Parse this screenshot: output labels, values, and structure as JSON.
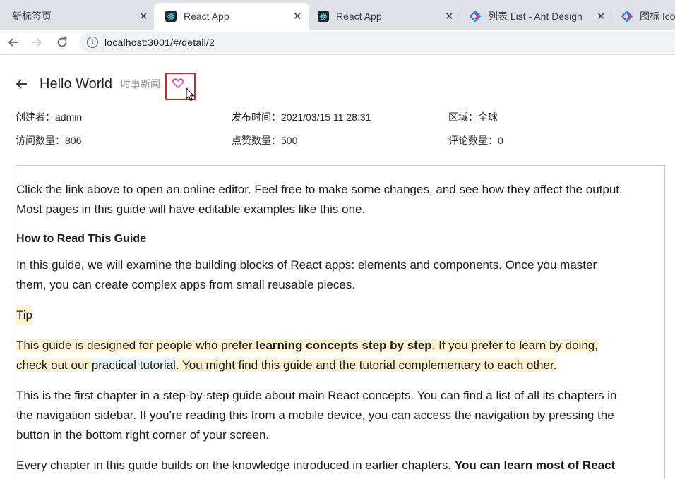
{
  "browser": {
    "tabs": [
      {
        "title": "新标签页",
        "favicon": "none"
      },
      {
        "title": "React App",
        "favicon": "react-icon"
      },
      {
        "title": "React App",
        "favicon": "react-icon"
      },
      {
        "title": "列表 List - Ant Design",
        "favicon": "ant-design-icon"
      },
      {
        "title": "图标 Icon",
        "favicon": "ant-design-icon"
      }
    ],
    "close_glyph": "✕",
    "url": "localhost:3001/#/detail/2"
  },
  "header": {
    "title": "Hello World",
    "subtitle": "时事新闻",
    "heart_color": "#eb2f96"
  },
  "descriptions": [
    {
      "label": "创建者：",
      "value": "admin"
    },
    {
      "label": "发布时间：",
      "value": "2021/03/15 11:28:31"
    },
    {
      "label": "区域：",
      "value": "全球"
    },
    {
      "label": "访问数量：",
      "value": "806"
    },
    {
      "label": "点赞数量：",
      "value": "500"
    },
    {
      "label": "评论数量：",
      "value": "0"
    }
  ],
  "article": {
    "intro_line1": "Click the link above to open an online editor. Feel free to make some changes, and see how they affect the output.",
    "intro_line2": "Most pages in this guide will have editable examples like this one.",
    "heading": "How to Read This Guide",
    "para2_line1": "In this guide, we will examine the building blocks of React apps: elements and components. Once you master",
    "para2_line2": "them, you can create complex apps from small reusable pieces.",
    "tip_label": "Tip",
    "tip_line1_a": "This guide is designed for people who prefer ",
    "tip_line1_bold": "learning concepts step by step",
    "tip_line1_b": ". If you prefer to learn by doing,",
    "tip_line2_a": "check out our ",
    "tip_line2_link": "practical tutorial",
    "tip_line2_b": ". You might find this guide and the tutorial complementary to each other.",
    "para4_line1": "This is the first chapter in a step-by-step guide about main React concepts. You can find a list of all its chapters in",
    "para4_line2": "the navigation sidebar. If you’re reading this from a mobile device, you can access the navigation by pressing the",
    "para4_line3": "button in the bottom right corner of your screen.",
    "para5_a": "Every chapter in this guide builds on the knowledge introduced in earlier chapters. ",
    "para5_bold": "You can learn most of React"
  }
}
